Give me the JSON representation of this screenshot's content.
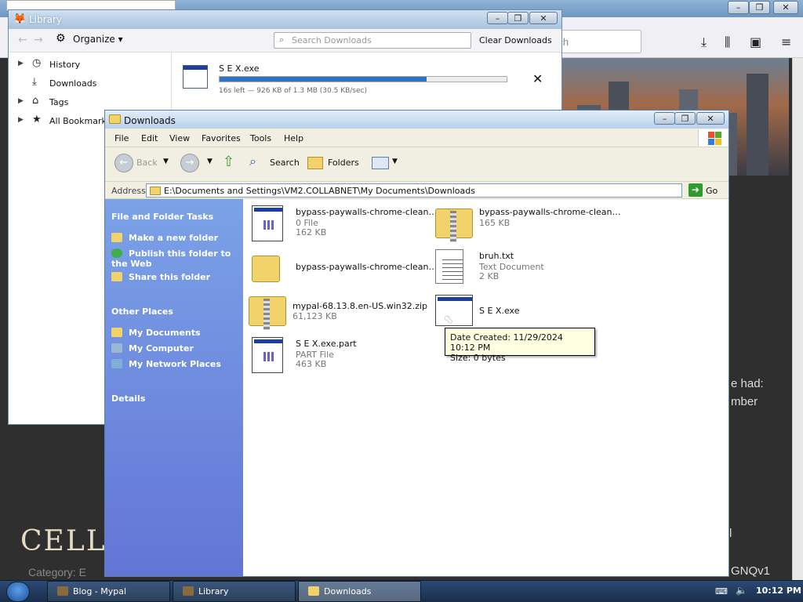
{
  "browser": {
    "search_placeholder": "rch",
    "page_title": "CELLO C",
    "category_label": "Category: E",
    "right_snippets": [
      "e had:",
      "mber",
      "GNQv1",
      "l"
    ]
  },
  "library": {
    "title": "Library",
    "organize_label": "Organize ▾",
    "search_placeholder": "Search Downloads",
    "clear_label": "Clear Downloads",
    "sidebar": [
      {
        "label": "History",
        "icon": "clock-icon"
      },
      {
        "label": "Downloads",
        "icon": "download-icon"
      },
      {
        "label": "Tags",
        "icon": "tag-icon"
      },
      {
        "label": "All Bookmarks",
        "icon": "star-icon"
      }
    ],
    "download": {
      "name": "S E X.exe",
      "progress": 0.72,
      "status": "16s left — 926 KB of 1.3 MB (30.5 KB/sec)"
    }
  },
  "explorer": {
    "title": "Downloads",
    "menu": [
      "File",
      "Edit",
      "View",
      "Favorites",
      "Tools",
      "Help"
    ],
    "toolbar": {
      "back": "Back",
      "search": "Search",
      "folders": "Folders"
    },
    "address_label": "Address",
    "address_path": "E:\\Documents and Settings\\VM2.COLLABNET\\My Documents\\Downloads",
    "go_label": "Go",
    "tasks": {
      "file_folder_heading": "File and Folder Tasks",
      "file_folder_links": [
        "Make a new folder",
        "Publish this folder to the Web",
        "Share this folder"
      ],
      "other_places_heading": "Other Places",
      "other_places_links": [
        "My Documents",
        "My Computer",
        "My Network Places"
      ],
      "details_heading": "Details"
    },
    "files": [
      {
        "name": "bypass-paywalls-chrome-clean-3....",
        "line2": "0 File",
        "line3": "162 KB",
        "type": "exe"
      },
      {
        "name": "bypass-paywalls-chrome-clean-v...",
        "line2": "165 KB",
        "line3": "",
        "type": "zip"
      },
      {
        "name": "bypass-paywalls-chrome-clean-v...",
        "line2": "",
        "line3": "",
        "type": "folder"
      },
      {
        "name": "bruh.txt",
        "line2": "Text Document",
        "line3": "2 KB",
        "type": "txt"
      },
      {
        "name": "mypal-68.13.8.en-US.win32.zip",
        "line2": "61,123 KB",
        "line3": "",
        "type": "zip"
      },
      {
        "name": "S E X.exe",
        "line2": "",
        "line3": "",
        "type": "exe"
      },
      {
        "name": "S E X.exe.part",
        "line2": "PART File",
        "line3": "463 KB",
        "type": "exe"
      }
    ],
    "tooltip": {
      "date_created": "Date Created: 11/29/2024 10:12 PM",
      "size": "Size: 0 bytes"
    }
  },
  "taskbar": {
    "buttons": [
      "Blog - Mypal",
      "Library",
      "Downloads"
    ],
    "active": "Downloads",
    "clock": "10:12 PM"
  }
}
